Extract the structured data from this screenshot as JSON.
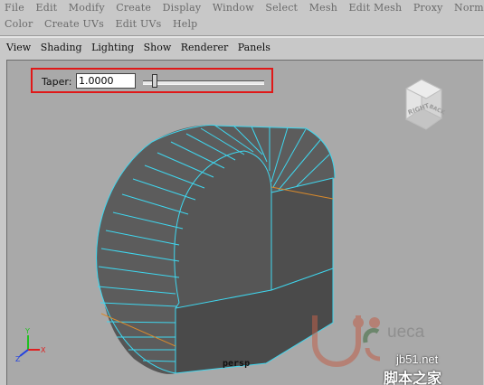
{
  "menus": {
    "row1": [
      "File",
      "Edit",
      "Modify",
      "Create",
      "Display",
      "Window",
      "Select",
      "Mesh",
      "Edit Mesh",
      "Proxy",
      "Normals"
    ],
    "row2": [
      "Color",
      "Create UVs",
      "Edit UVs",
      "Help"
    ]
  },
  "panel_menu": [
    "View",
    "Shading",
    "Lighting",
    "Show",
    "Renderer",
    "Panels"
  ],
  "taper": {
    "label": "Taper:",
    "value": "1.0000",
    "slider_fraction": 0.08
  },
  "viewport": {
    "camera_label": "persp",
    "view_cube": {
      "right_face": "RIGHT",
      "back_face": "BACK"
    },
    "axis": {
      "y": "Y",
      "x": "X",
      "z": "Z"
    }
  },
  "watermark": {
    "logo_text": "ueca",
    "site": "jb51.net",
    "site_cn": "脚本之家"
  },
  "colors": {
    "highlight_box": "#e01818",
    "wire": "#40d8f0",
    "mesh": "#4d4d4d",
    "edge_orange": "#e0902a"
  }
}
